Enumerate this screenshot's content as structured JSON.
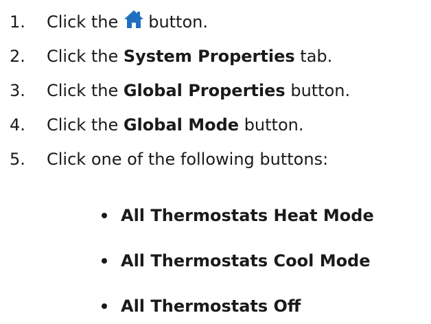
{
  "steps": [
    {
      "num": "1.",
      "before": "Click the",
      "after": "button.",
      "icon": "home-icon"
    },
    {
      "num": "2.",
      "before": "Click the",
      "bold": "System Properties",
      "after": "tab."
    },
    {
      "num": "3.",
      "before": "Click the",
      "bold": "Global Properties",
      "after": "button."
    },
    {
      "num": "4.",
      "before": "Click the",
      "bold": "Global Mode",
      "after": "button."
    },
    {
      "num": "5.",
      "text": "Click one of the following buttons:"
    }
  ],
  "options": [
    "All Thermostats Heat Mode",
    "All Thermostats Cool Mode",
    "All Thermostats Off"
  ],
  "colors": {
    "text": "#1a1a1a",
    "home_icon": "#1f6fbf"
  }
}
